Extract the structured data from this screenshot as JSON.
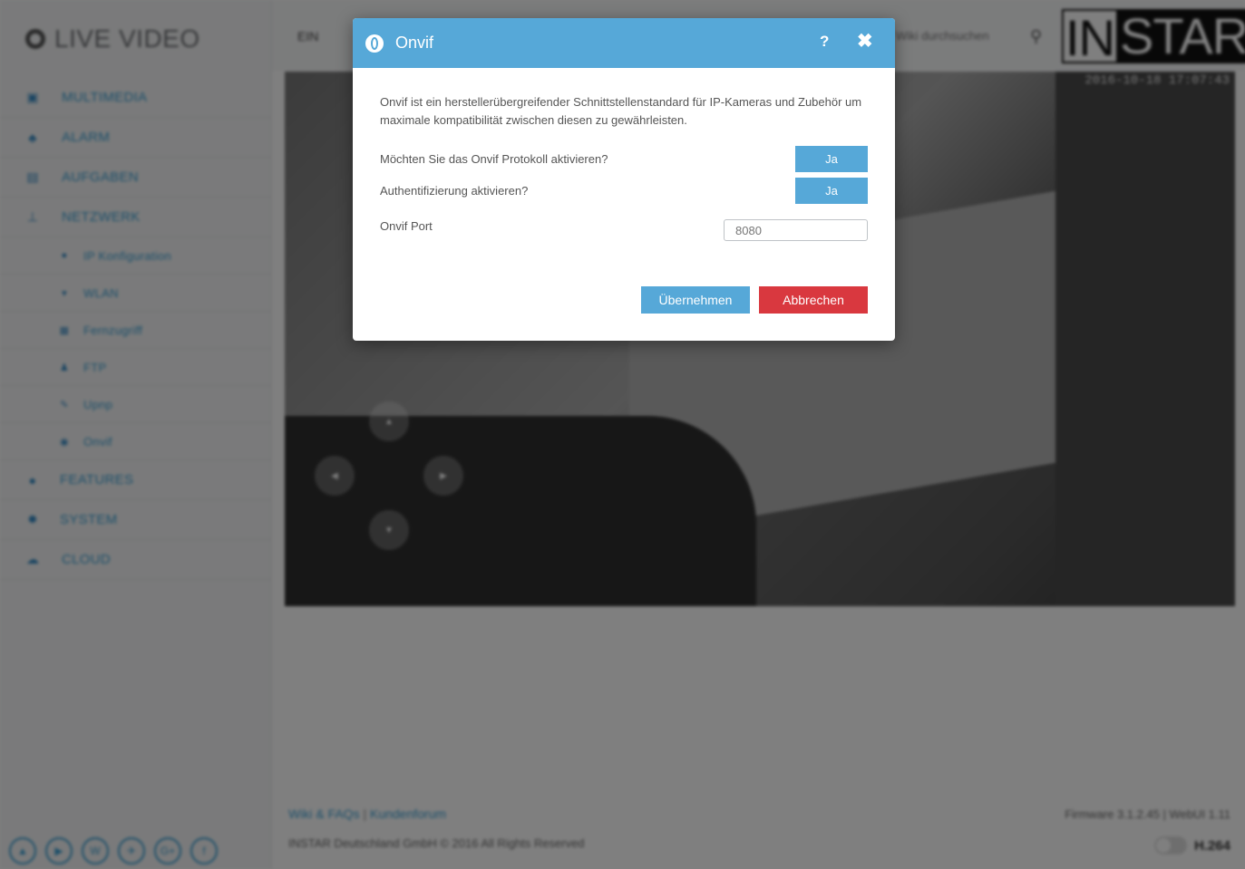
{
  "app": {
    "brand": "LIVE VIDEO",
    "logo_left": "IN",
    "logo_right": "STAR"
  },
  "sidebar": {
    "items": [
      {
        "label": "MULTIMEDIA",
        "icon": "image-icon"
      },
      {
        "label": "ALARM",
        "icon": "bell-icon"
      },
      {
        "label": "AUFGABEN",
        "icon": "film-icon"
      },
      {
        "label": "NETZWERK",
        "icon": "network-icon"
      }
    ],
    "subitems": [
      {
        "label": "IP Konfiguration",
        "icon": "globe-icon"
      },
      {
        "label": "WLAN",
        "icon": "wifi-icon"
      },
      {
        "label": "Fernzugriff",
        "icon": "grid-icon"
      },
      {
        "label": "FTP",
        "icon": "user-icon"
      },
      {
        "label": "Upnp",
        "icon": "link-icon"
      },
      {
        "label": "Onvif",
        "icon": "onvif-icon"
      }
    ],
    "items2": [
      {
        "label": "FEATURES",
        "icon": "dot-icon"
      },
      {
        "label": "SYSTEM",
        "icon": "gear-icon"
      },
      {
        "label": "CLOUD",
        "icon": "cloud-icon"
      }
    ]
  },
  "topbar": {
    "quick_label": "EIN",
    "search_placeholder": "Wiki durchsuchen"
  },
  "video": {
    "timestamp": "2016-10-18 17:07:43"
  },
  "footer": {
    "link_wiki": "Wiki & FAQs",
    "link_sep": "|",
    "link_forum": "Kundenforum",
    "copyright": "INSTAR Deutschland GmbH © 2016 All Rights Reserved",
    "firmware": "Firmware 3.1.2.45 | WebUI 1.11",
    "codec": "H.264"
  },
  "modal": {
    "title": "Onvif",
    "help_label": "?",
    "close_label": "✖",
    "description": "Onvif ist ein herstellerübergreifender Schnittstellenstandard für IP-Kameras und Zubehör um maximale kompatibilität zwischen diesen zu gewährleisten.",
    "protocol_label": "Möchten Sie das Onvif Protokoll aktivieren?",
    "protocol_value": "Ja",
    "auth_label": "Authentifizierung aktivieren?",
    "auth_value": "Ja",
    "port_label": "Onvif Port",
    "port_value": "8080",
    "apply_label": "Übernehmen",
    "cancel_label": "Abbrechen"
  },
  "colors": {
    "accent": "#56a8d8",
    "danger": "#d9383f"
  }
}
